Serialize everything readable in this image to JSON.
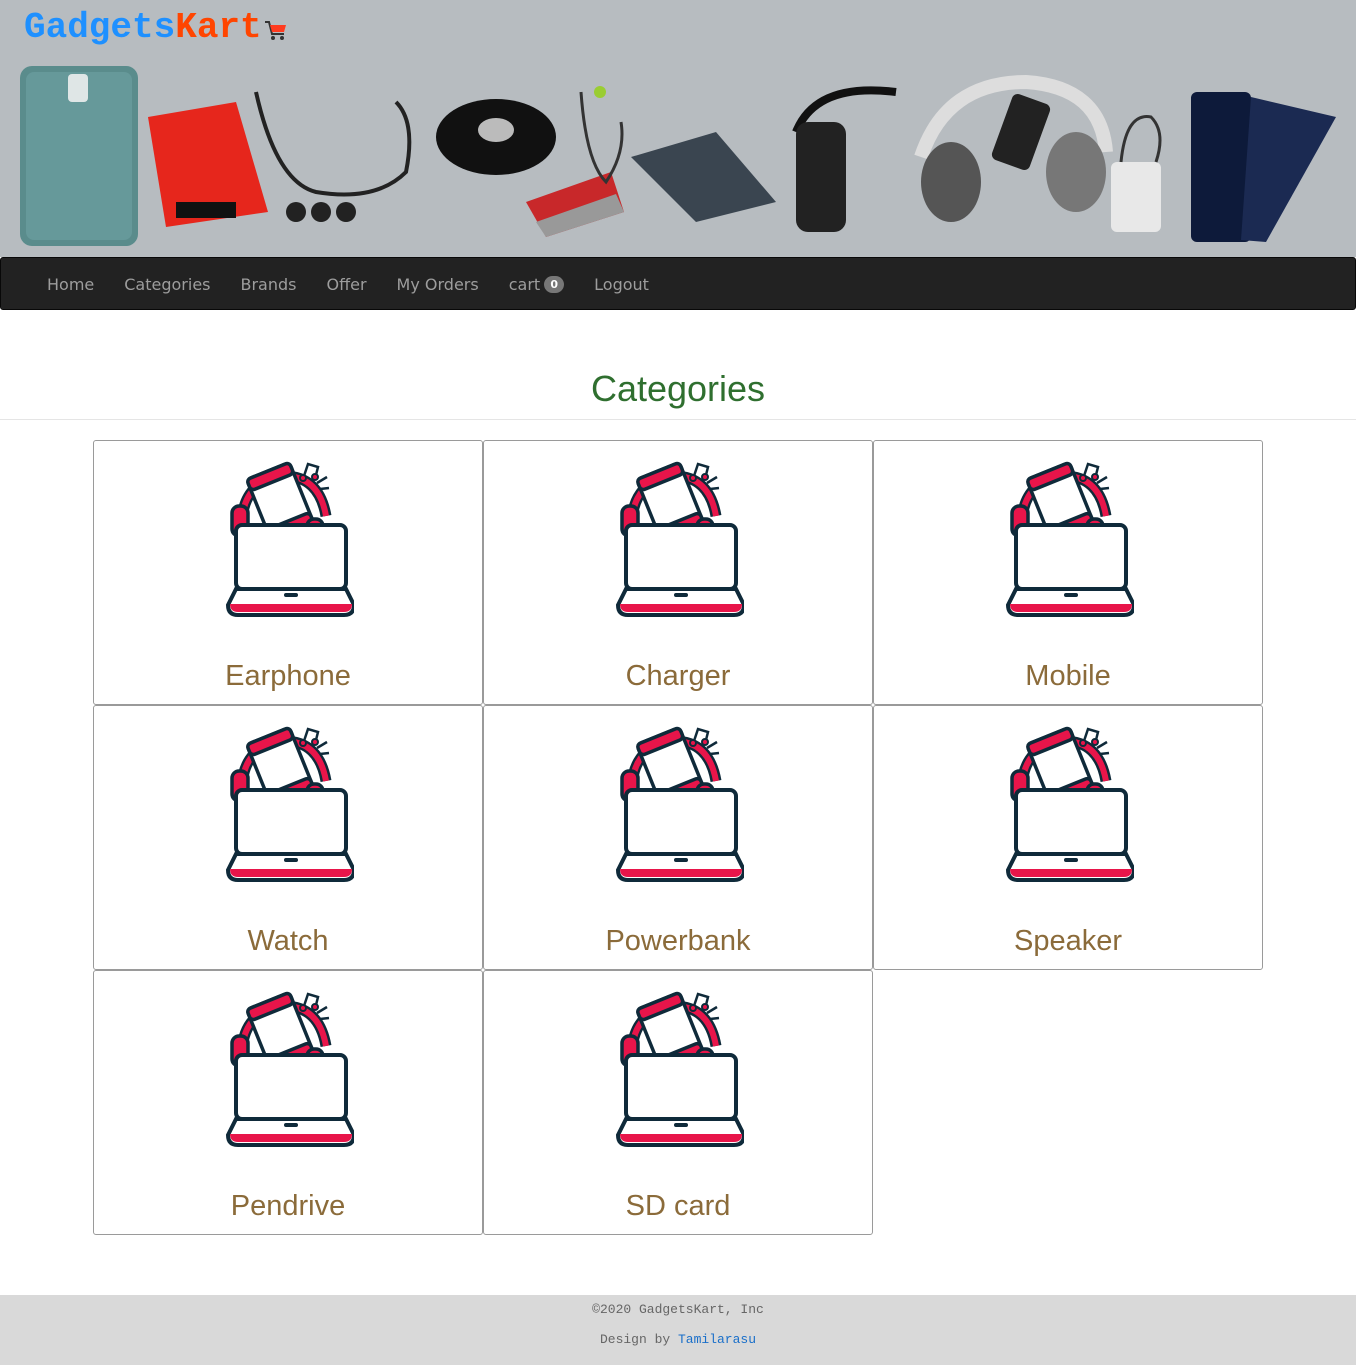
{
  "brand": {
    "part1": "Gadgets",
    "part2": "Kart"
  },
  "nav": {
    "home": "Home",
    "categories": "Categories",
    "brands": "Brands",
    "offer": "Offer",
    "orders": "My Orders",
    "cart": "cart",
    "cart_count": "0",
    "logout": "Logout"
  },
  "page_title": "Categories",
  "categories": [
    {
      "label": "Earphone"
    },
    {
      "label": "Charger"
    },
    {
      "label": "Mobile"
    },
    {
      "label": "Watch"
    },
    {
      "label": "Powerbank"
    },
    {
      "label": "Speaker"
    },
    {
      "label": "Pendrive"
    },
    {
      "label": "SD card"
    }
  ],
  "footer": {
    "copyright": "©2020 GadgetsKart, Inc",
    "design_prefix": "Design by",
    "designer": "Tamilarasu"
  },
  "colors": {
    "brand_blue": "#1e90ff",
    "brand_orange": "#ff4500",
    "title_green": "#2f6f2f",
    "label_brown": "#8b6b3a",
    "icon_red": "#e8154a",
    "icon_navy": "#0f2a3a"
  }
}
